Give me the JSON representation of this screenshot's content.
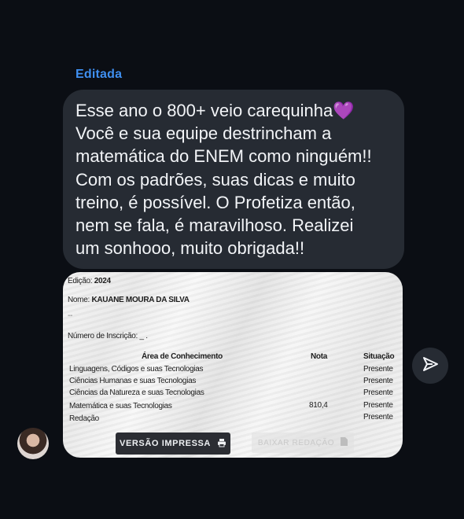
{
  "message": {
    "status_label": "Editada",
    "text": "Esse ano o 800+ veio carequinha",
    "heart_emoji": "💜",
    "text_rest": "Você e sua equipe destrincham a\nmatemática do ENEM como ninguém!!\nCom os padrões, suas dicas e muito\ntreino, é possível. O Profetiza então,\nnem se fala, é maravilhoso. Realizei\num sonhooo, muito obrigada!!"
  },
  "document": {
    "edition_label": "Edição:",
    "edition_value": "2024",
    "name_label": "Nome:",
    "name_value": "KAUANE MOURA DA SILVA",
    "blur_text": "-- ",
    "registration_label": "Número de Inscrição:",
    "registration_value": "_ .",
    "table": {
      "headers": [
        "Área de Conhecimento",
        "Nota",
        "Situação"
      ],
      "rows": [
        {
          "area": "Linguagens, Códigos e suas Tecnologias",
          "score": "",
          "status": "Presente"
        },
        {
          "area": "Ciências Humanas e suas Tecnologias",
          "score": "",
          "status": "Presente"
        },
        {
          "area": "Ciências da Natureza e suas Tecnologias",
          "score": "",
          "status": "Presente"
        },
        {
          "area": "Matemática e suas Tecnologias",
          "score": "810,4",
          "status": "Presente"
        },
        {
          "area": "Redação",
          "score": "",
          "status": "Presente"
        }
      ]
    },
    "print_button": "VERSÃO IMPRESSA",
    "download_button": "BAIXAR REDAÇÃO"
  },
  "icons": {
    "send": "send-icon",
    "printer": "printer-icon",
    "file": "file-icon"
  },
  "colors": {
    "background": "#0b0e14",
    "bubble": "#262b33",
    "accent": "#3f8ff0",
    "heart": "#9b40e8"
  }
}
